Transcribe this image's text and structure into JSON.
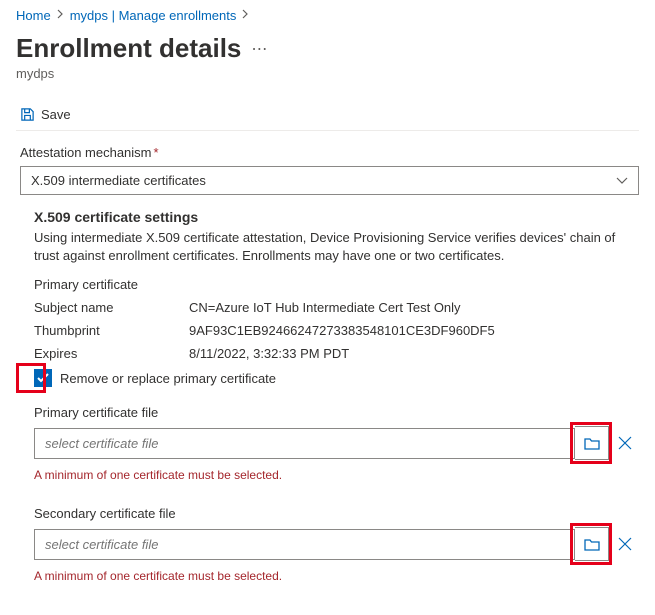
{
  "breadcrumb": {
    "home": "Home",
    "item1": "mydps | Manage enrollments"
  },
  "page": {
    "title": "Enrollment details",
    "subtitle": "mydps"
  },
  "toolbar": {
    "save_label": "Save"
  },
  "form": {
    "attestation_label": "Attestation mechanism",
    "attestation_value": "X.509 intermediate certificates",
    "x509": {
      "heading": "X.509 certificate settings",
      "description": "Using intermediate X.509 certificate attestation, Device Provisioning Service verifies devices' chain of trust against enrollment certificates. Enrollments may have one or two certificates.",
      "primary_heading": "Primary certificate",
      "subject_label": "Subject name",
      "subject_value": "CN=Azure IoT Hub Intermediate Cert Test Only",
      "thumbprint_label": "Thumbprint",
      "thumbprint_value": "9AF93C1EB92466247273383548101CE3DF960DF5",
      "expires_label": "Expires",
      "expires_value": "8/11/2022, 3:32:33 PM PDT",
      "remove_label": "Remove or replace primary certificate",
      "primary_file_label": "Primary certificate file",
      "secondary_file_label": "Secondary certificate file",
      "file_placeholder": "select certificate file",
      "error_msg": "A minimum of one certificate must be selected."
    }
  }
}
